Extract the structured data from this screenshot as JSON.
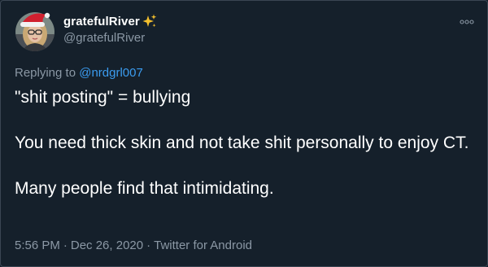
{
  "user": {
    "display_name": "gratefulRiver",
    "handle": "@gratefulRiver",
    "badge_icon": "sparkles-icon",
    "avatar_icon": "avatar-santa-hat"
  },
  "reply": {
    "prefix": "Replying to ",
    "mention": "@nrdgrl007"
  },
  "tweet": {
    "paragraphs": [
      "\"shit posting\" = bullying",
      "You need thick skin and not take shit personally to enjoy CT.",
      "Many people find that intimidating."
    ]
  },
  "meta": {
    "time": "5:56 PM",
    "separator": "·",
    "date": "Dec 26, 2020",
    "client": "Twitter for Android"
  },
  "colors": {
    "background": "#15202b",
    "secondary_text": "#8b98a5",
    "link": "#3b9cf0",
    "badge": "#f5c12e"
  },
  "more_menu_icon": "more-options-icon"
}
